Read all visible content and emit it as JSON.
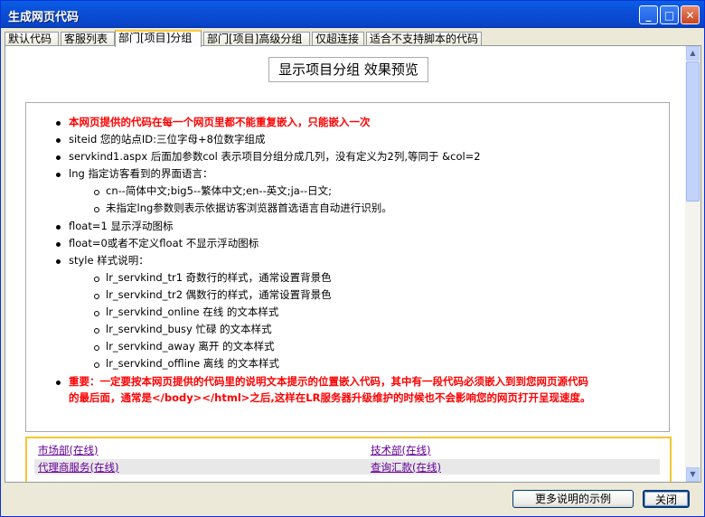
{
  "window": {
    "title": "生成网页代码"
  },
  "title_buttons": {
    "minimize": "_",
    "maximize": "□",
    "close": "✕"
  },
  "tabs": [
    {
      "label": "默认代码"
    },
    {
      "label": "客服列表"
    },
    {
      "label": "部门[项目]分组"
    },
    {
      "label": "部门[项目]高级分组"
    },
    {
      "label": "仅超连接"
    },
    {
      "label": "适合不支持脚本的代码"
    }
  ],
  "preview": {
    "title": "显示项目分组  效果预览",
    "items": [
      {
        "text": "本网页提供的代码在每一个网页里都不能重复嵌入，只能嵌入一次"
      },
      {
        "text": "siteid 您的站点ID:三位字母+8位数字组成"
      },
      {
        "text": "servkind1.aspx 后面加参数col 表示项目分组分成几列，没有定义为2列,等同于 &col=2"
      },
      {
        "text": "lng 指定访客看到的界面语言："
      },
      {
        "text": "cn--简体中文;big5--繁体中文;en--英文;ja--日文;"
      },
      {
        "text": "未指定lng参数则表示依据访客浏览器首选语言自动进行识别。"
      },
      {
        "text": "float=1 显示浮动图标"
      },
      {
        "text": "float=0或者不定义float 不显示浮动图标"
      },
      {
        "text": "style 样式说明："
      },
      {
        "text": "lr_servkind_tr1 奇数行的样式，通常设置背景色"
      },
      {
        "text": "lr_servkind_tr2 偶数行的样式，通常设置背景色"
      },
      {
        "text": "lr_servkind_online 在线 的文本样式"
      },
      {
        "text": "lr_servkind_busy 忙碌 的文本样式"
      },
      {
        "text": "lr_servkind_away 离开 的文本样式"
      },
      {
        "text": "lr_servkind_offline 离线 的文本样式"
      },
      {
        "text": "重要：一定要按本网页提供的代码里的说明文本提示的位置嵌入代码，其中有一段代码必须嵌入到到您网页源代码"
      },
      {
        "text": "的最后面，通常是</body></html>之后,这样在LR服务器升级维护的时候也不会影响您的网页打开呈现速度。"
      }
    ]
  },
  "groups": [
    {
      "label": "市场部(在线)"
    },
    {
      "label": "技术部(在线)"
    },
    {
      "label": "代理商服务(在线)"
    },
    {
      "label": "查询汇款(在线)"
    }
  ],
  "buttons": {
    "more_examples": "更多说明的示例",
    "close": "关闭"
  },
  "colors": {
    "warning": "#ff0000",
    "titlebar": "#0a5fe8",
    "link": "#660099",
    "group_border": "#f0c832"
  }
}
